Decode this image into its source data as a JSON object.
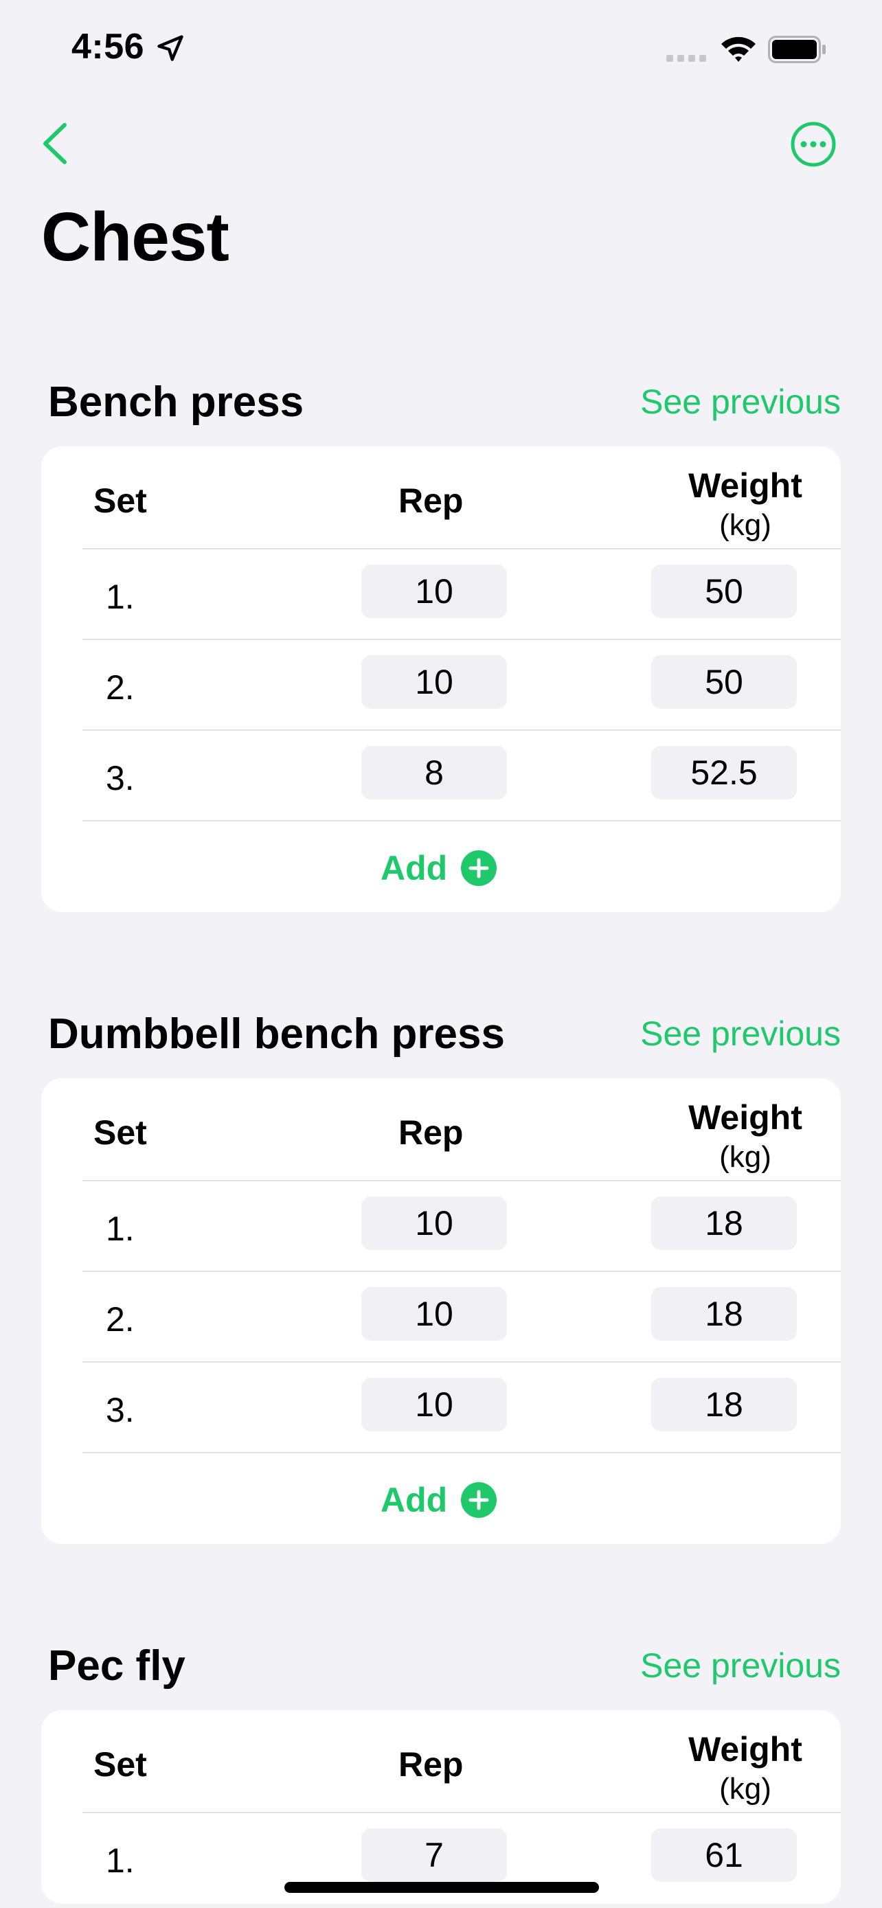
{
  "status": {
    "time": "4:56"
  },
  "page": {
    "title": "Chest"
  },
  "labels": {
    "see_previous": "See previous",
    "add": "Add",
    "set": "Set",
    "rep": "Rep",
    "weight": "Weight",
    "unit": "(kg)"
  },
  "exercises": [
    {
      "name": "Bench press",
      "sets": [
        {
          "num": "1.",
          "rep": "10",
          "weight": "50"
        },
        {
          "num": "2.",
          "rep": "10",
          "weight": "50"
        },
        {
          "num": "3.",
          "rep": "8",
          "weight": "52.5"
        }
      ]
    },
    {
      "name": "Dumbbell bench press",
      "sets": [
        {
          "num": "1.",
          "rep": "10",
          "weight": "18"
        },
        {
          "num": "2.",
          "rep": "10",
          "weight": "18"
        },
        {
          "num": "3.",
          "rep": "10",
          "weight": "18"
        }
      ]
    },
    {
      "name": "Pec fly",
      "sets": [
        {
          "num": "1.",
          "rep": "7",
          "weight": "61"
        }
      ]
    }
  ],
  "icons": {
    "back": "chevron-left-icon",
    "more": "ellipsis-circle-icon",
    "add": "plus-circle-icon"
  },
  "colors": {
    "accent": "#1fc86a",
    "background": "#f2f2f7",
    "card": "#ffffff",
    "field": "#f0f0f5"
  }
}
